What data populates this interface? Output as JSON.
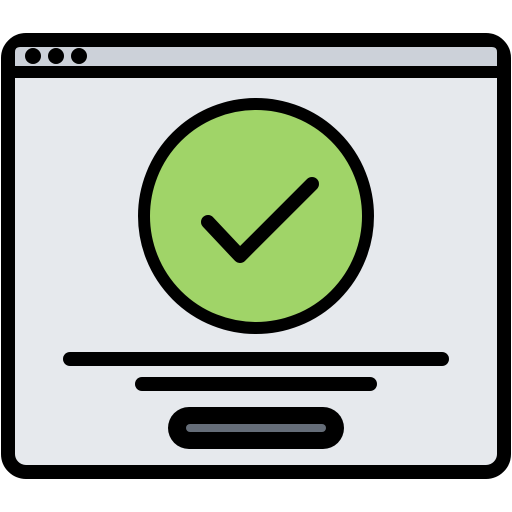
{
  "illustration": {
    "icon_name": "browser-window-success-icon",
    "window": {
      "titlebar_dots": [
        "dot-1",
        "dot-2",
        "dot-3"
      ]
    },
    "badge": {
      "icon_name": "checkmark-icon",
      "status": "success"
    },
    "text_placeholder_lines": 2,
    "button": {
      "label": ""
    }
  },
  "colors": {
    "outline": "#000000",
    "window_fill": "#e6e9ed",
    "titlebar_fill": "#ccd1d9",
    "badge_fill": "#a0d468",
    "badge_shade": "#8cc152",
    "button_fill": "#656d78",
    "background": "#ffffff"
  }
}
